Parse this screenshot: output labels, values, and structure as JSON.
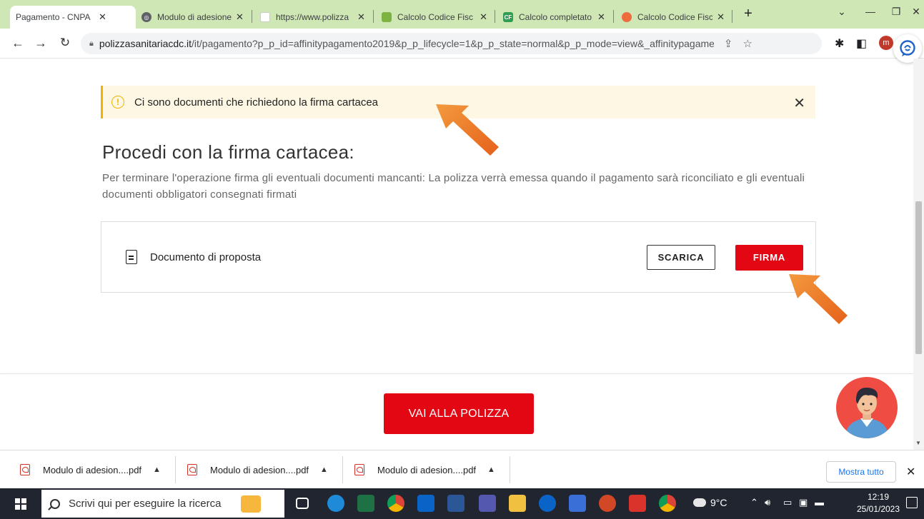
{
  "browser": {
    "tabs": [
      {
        "title": "Pagamento - CNPA",
        "favicon": "page-icon",
        "active": true
      },
      {
        "title": "Modulo di adesione",
        "favicon": "globe-icon"
      },
      {
        "title": "https://www.polizza",
        "favicon": "blank-page-icon"
      },
      {
        "title": "Calcolo Codice Fisc",
        "favicon": "calc-icon"
      },
      {
        "title": "Calcolo completato",
        "favicon": "cf-icon"
      },
      {
        "title": "Calcolo Codice Fisc",
        "favicon": "circle-icon"
      }
    ],
    "new_tab": "+",
    "url_host": "polizzasanitariacdc.it",
    "url_path": "/it/pagamento?p_p_id=affinitypagamento2019&p_p_lifecycle=1&p_p_state=normal&p_p_mode=view&_affinitypagamento2019...",
    "profile_initial": "m"
  },
  "page": {
    "alert_text": "Ci sono documenti che richiedono la firma cartacea",
    "heading": "Procedi con la firma cartacea:",
    "description": "Per terminare l'operazione firma gli eventuali documenti mancanti: La polizza verrà emessa quando il pagamento sarà riconciliato e gli eventuali documenti obbligatori consegnati firmati",
    "document_label": "Documento di proposta",
    "download_button": "SCARICA",
    "sign_button": "FIRMA",
    "primary_button": "VAI ALLA POLIZZA",
    "accent_color": "#e30613",
    "alert_color": "#f0b400",
    "arrow_color": "#f07a1c"
  },
  "downloads": {
    "items": [
      {
        "name": "Modulo di adesion....pdf"
      },
      {
        "name": "Modulo di adesion....pdf"
      },
      {
        "name": "Modulo di adesion....pdf"
      }
    ],
    "show_all": "Mostra tutto"
  },
  "taskbar": {
    "search_placeholder": "Scrivi qui per eseguire la ricerca",
    "temperature": "9°C",
    "time": "12:19",
    "date": "25/01/2023"
  }
}
